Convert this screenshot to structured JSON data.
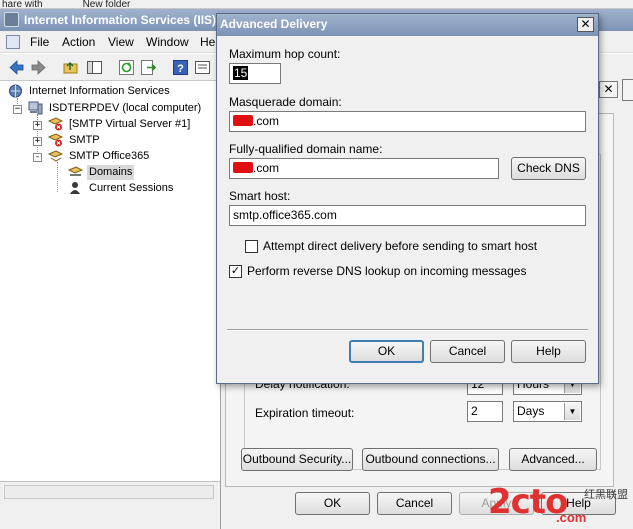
{
  "top_strip": {
    "left_text": "hare with",
    "right_text": "New folder"
  },
  "iis_window": {
    "title": "Internet Information Services (IIS) 6.0 Manager",
    "menu": [
      "File",
      "Action",
      "View",
      "Window",
      "Help"
    ]
  },
  "tree": {
    "root": "Internet Information Services",
    "computer": "ISDTERPDEV (local computer)",
    "items": [
      {
        "label": "[SMTP Virtual Server #1]",
        "expand": "+"
      },
      {
        "label": "SMTP",
        "expand": "+"
      },
      {
        "label": "SMTP Office365",
        "expand": "-"
      }
    ],
    "children": [
      {
        "label": "Domains",
        "selected": true
      },
      {
        "label": "Current Sessions",
        "selected": false
      }
    ]
  },
  "properties_dialog": {
    "delay_notification_label": "Delay notification:",
    "delay_notification_value": "12",
    "delay_notification_unit": "Hours",
    "expiration_timeout_label": "Expiration timeout:",
    "expiration_timeout_value": "2",
    "expiration_timeout_unit": "Days",
    "outbound_security_button": "Outbound Security...",
    "outbound_connections_button": "Outbound connections...",
    "advanced_button": "Advanced...",
    "ok_button": "OK",
    "cancel_button": "Cancel",
    "apply_button": "Apply",
    "help_button": "Help"
  },
  "advanced_delivery": {
    "title": "Advanced Delivery",
    "max_hop_label": "Maximum hop count:",
    "max_hop_value": "15",
    "masquerade_label": "Masquerade domain:",
    "masquerade_value_suffix": ".com",
    "fqdn_label": "Fully-qualified domain name:",
    "fqdn_value_suffix": ".com",
    "check_dns_button": "Check DNS",
    "smart_host_label": "Smart host:",
    "smart_host_value": "smtp.office365.com",
    "attempt_direct_label": "Attempt direct delivery before sending to smart host",
    "attempt_direct_checked": false,
    "reverse_dns_label": "Perform reverse DNS lookup on incoming messages",
    "reverse_dns_checked": true,
    "ok_button": "OK",
    "cancel_button": "Cancel",
    "help_button": "Help"
  },
  "watermark": {
    "logo": "2cto",
    "dot": ".com",
    "cn": "红黑联盟"
  },
  "colors": {
    "title_bar": "#8ea3c2",
    "selection": "#d9d9d9",
    "default_button": "#3c7fb1"
  }
}
